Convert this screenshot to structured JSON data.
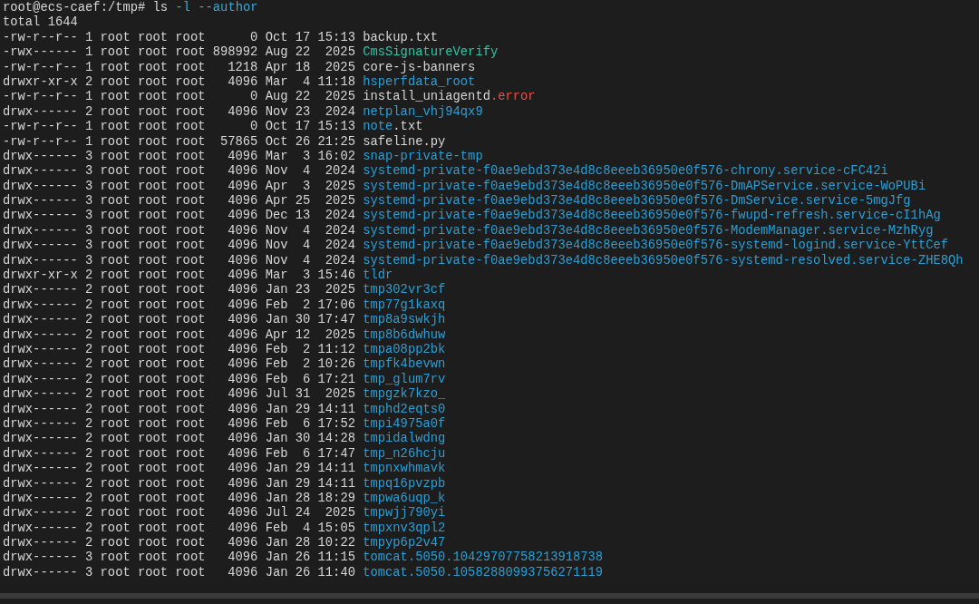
{
  "prompt": {
    "user_host_path": "root@ecs-caef:/tmp#",
    "command": "ls",
    "args": "-l --author"
  },
  "total": "total 1644",
  "entries": [
    {
      "perms": "-rw-r--r--",
      "links": "1",
      "owner": "root",
      "group": "root",
      "author": "root",
      "size": "0",
      "month": "Oct",
      "day": "17",
      "time": "15:13",
      "name": [
        {
          "text": "backup.txt",
          "kind": "plain"
        }
      ]
    },
    {
      "perms": "-rwx------",
      "links": "1",
      "owner": "root",
      "group": "root",
      "author": "root",
      "size": "898992",
      "month": "Aug",
      "day": "22",
      "time": "2025",
      "name": [
        {
          "text": "CmsSignatureVerify",
          "kind": "exec"
        }
      ]
    },
    {
      "perms": "-rw-r--r--",
      "links": "1",
      "owner": "root",
      "group": "root",
      "author": "root",
      "size": "1218",
      "month": "Apr",
      "day": "18",
      "time": "2025",
      "name": [
        {
          "text": "core-js-banners",
          "kind": "plain"
        }
      ]
    },
    {
      "perms": "drwxr-xr-x",
      "links": "2",
      "owner": "root",
      "group": "root",
      "author": "root",
      "size": "4096",
      "month": "Mar",
      "day": "4",
      "time": "11:18",
      "name": [
        {
          "text": "hsperfdata_root",
          "kind": "dir"
        }
      ]
    },
    {
      "perms": "-rw-r--r--",
      "links": "1",
      "owner": "root",
      "group": "root",
      "author": "root",
      "size": "0",
      "month": "Aug",
      "day": "22",
      "time": "2025",
      "name": [
        {
          "text": "install_uniagentd",
          "kind": "plain"
        },
        {
          "text": ".error",
          "kind": "error"
        }
      ]
    },
    {
      "perms": "drwx------",
      "links": "2",
      "owner": "root",
      "group": "root",
      "author": "root",
      "size": "4096",
      "month": "Nov",
      "day": "23",
      "time": "2024",
      "name": [
        {
          "text": "netplan_vhj94qx9",
          "kind": "dir"
        }
      ]
    },
    {
      "perms": "-rw-r--r--",
      "links": "1",
      "owner": "root",
      "group": "root",
      "author": "root",
      "size": "0",
      "month": "Oct",
      "day": "17",
      "time": "15:13",
      "name": [
        {
          "text": "note",
          "kind": "dir"
        },
        {
          "text": ".txt",
          "kind": "plain"
        }
      ]
    },
    {
      "perms": "-rw-r--r--",
      "links": "1",
      "owner": "root",
      "group": "root",
      "author": "root",
      "size": "57865",
      "month": "Oct",
      "day": "26",
      "time": "21:25",
      "name": [
        {
          "text": "safeline.py",
          "kind": "plain"
        }
      ]
    },
    {
      "perms": "drwx------",
      "links": "3",
      "owner": "root",
      "group": "root",
      "author": "root",
      "size": "4096",
      "month": "Mar",
      "day": "3",
      "time": "16:02",
      "name": [
        {
          "text": "snap-private-tmp",
          "kind": "dir"
        }
      ]
    },
    {
      "perms": "drwx------",
      "links": "3",
      "owner": "root",
      "group": "root",
      "author": "root",
      "size": "4096",
      "month": "Nov",
      "day": "4",
      "time": "2024",
      "name": [
        {
          "text": "systemd-private-f0ae9ebd373e4d8c8eeeb36950e0f576-chrony.service-cFC42i",
          "kind": "dir"
        }
      ]
    },
    {
      "perms": "drwx------",
      "links": "3",
      "owner": "root",
      "group": "root",
      "author": "root",
      "size": "4096",
      "month": "Apr",
      "day": "3",
      "time": "2025",
      "name": [
        {
          "text": "systemd-private-f0ae9ebd373e4d8c8eeeb36950e0f576-DmAPService.service-WoPUBi",
          "kind": "dir"
        }
      ]
    },
    {
      "perms": "drwx------",
      "links": "3",
      "owner": "root",
      "group": "root",
      "author": "root",
      "size": "4096",
      "month": "Apr",
      "day": "25",
      "time": "2025",
      "name": [
        {
          "text": "systemd-private-f0ae9ebd373e4d8c8eeeb36950e0f576-DmService.service-5mgJfg",
          "kind": "dir"
        }
      ]
    },
    {
      "perms": "drwx------",
      "links": "3",
      "owner": "root",
      "group": "root",
      "author": "root",
      "size": "4096",
      "month": "Dec",
      "day": "13",
      "time": "2024",
      "name": [
        {
          "text": "systemd-private-f0ae9ebd373e4d8c8eeeb36950e0f576-fwupd-refresh.service-cI1hAg",
          "kind": "dir"
        }
      ]
    },
    {
      "perms": "drwx------",
      "links": "3",
      "owner": "root",
      "group": "root",
      "author": "root",
      "size": "4096",
      "month": "Nov",
      "day": "4",
      "time": "2024",
      "name": [
        {
          "text": "systemd-private-f0ae9ebd373e4d8c8eeeb36950e0f576-ModemManager.service-MzhRyg",
          "kind": "dir"
        }
      ]
    },
    {
      "perms": "drwx------",
      "links": "3",
      "owner": "root",
      "group": "root",
      "author": "root",
      "size": "4096",
      "month": "Nov",
      "day": "4",
      "time": "2024",
      "name": [
        {
          "text": "systemd-private-f0ae9ebd373e4d8c8eeeb36950e0f576-systemd-logind.service-YttCef",
          "kind": "dir"
        }
      ]
    },
    {
      "perms": "drwx------",
      "links": "3",
      "owner": "root",
      "group": "root",
      "author": "root",
      "size": "4096",
      "month": "Nov",
      "day": "4",
      "time": "2024",
      "name": [
        {
          "text": "systemd-private-f0ae9ebd373e4d8c8eeeb36950e0f576-systemd-resolved.service-ZHE8Qh",
          "kind": "dir"
        }
      ]
    },
    {
      "perms": "drwxr-xr-x",
      "links": "2",
      "owner": "root",
      "group": "root",
      "author": "root",
      "size": "4096",
      "month": "Mar",
      "day": "3",
      "time": "15:46",
      "name": [
        {
          "text": "tldr",
          "kind": "dir"
        }
      ]
    },
    {
      "perms": "drwx------",
      "links": "2",
      "owner": "root",
      "group": "root",
      "author": "root",
      "size": "4096",
      "month": "Jan",
      "day": "23",
      "time": "2025",
      "name": [
        {
          "text": "tmp302vr3cf",
          "kind": "dir"
        }
      ]
    },
    {
      "perms": "drwx------",
      "links": "2",
      "owner": "root",
      "group": "root",
      "author": "root",
      "size": "4096",
      "month": "Feb",
      "day": "2",
      "time": "17:06",
      "name": [
        {
          "text": "tmp77g1kaxq",
          "kind": "dir"
        }
      ]
    },
    {
      "perms": "drwx------",
      "links": "2",
      "owner": "root",
      "group": "root",
      "author": "root",
      "size": "4096",
      "month": "Jan",
      "day": "30",
      "time": "17:47",
      "name": [
        {
          "text": "tmp8a9swkjh",
          "kind": "dir"
        }
      ]
    },
    {
      "perms": "drwx------",
      "links": "2",
      "owner": "root",
      "group": "root",
      "author": "root",
      "size": "4096",
      "month": "Apr",
      "day": "12",
      "time": "2025",
      "name": [
        {
          "text": "tmp8b6dwhuw",
          "kind": "dir"
        }
      ]
    },
    {
      "perms": "drwx------",
      "links": "2",
      "owner": "root",
      "group": "root",
      "author": "root",
      "size": "4096",
      "month": "Feb",
      "day": "2",
      "time": "11:12",
      "name": [
        {
          "text": "tmpa08pp2bk",
          "kind": "dir"
        }
      ]
    },
    {
      "perms": "drwx------",
      "links": "2",
      "owner": "root",
      "group": "root",
      "author": "root",
      "size": "4096",
      "month": "Feb",
      "day": "2",
      "time": "10:26",
      "name": [
        {
          "text": "tmpfk4bevwn",
          "kind": "dir"
        }
      ]
    },
    {
      "perms": "drwx------",
      "links": "2",
      "owner": "root",
      "group": "root",
      "author": "root",
      "size": "4096",
      "month": "Feb",
      "day": "6",
      "time": "17:21",
      "name": [
        {
          "text": "tmp_glum7rv",
          "kind": "dir"
        }
      ]
    },
    {
      "perms": "drwx------",
      "links": "2",
      "owner": "root",
      "group": "root",
      "author": "root",
      "size": "4096",
      "month": "Jul",
      "day": "31",
      "time": "2025",
      "name": [
        {
          "text": "tmpgzk7kzo_",
          "kind": "dir"
        }
      ]
    },
    {
      "perms": "drwx------",
      "links": "2",
      "owner": "root",
      "group": "root",
      "author": "root",
      "size": "4096",
      "month": "Jan",
      "day": "29",
      "time": "14:11",
      "name": [
        {
          "text": "tmphd2eqts0",
          "kind": "dir"
        }
      ]
    },
    {
      "perms": "drwx------",
      "links": "2",
      "owner": "root",
      "group": "root",
      "author": "root",
      "size": "4096",
      "month": "Feb",
      "day": "6",
      "time": "17:52",
      "name": [
        {
          "text": "tmpi4975a0f",
          "kind": "dir"
        }
      ]
    },
    {
      "perms": "drwx------",
      "links": "2",
      "owner": "root",
      "group": "root",
      "author": "root",
      "size": "4096",
      "month": "Jan",
      "day": "30",
      "time": "14:28",
      "name": [
        {
          "text": "tmpidalwdng",
          "kind": "dir"
        }
      ]
    },
    {
      "perms": "drwx------",
      "links": "2",
      "owner": "root",
      "group": "root",
      "author": "root",
      "size": "4096",
      "month": "Feb",
      "day": "6",
      "time": "17:47",
      "name": [
        {
          "text": "tmp_n26hcju",
          "kind": "dir"
        }
      ]
    },
    {
      "perms": "drwx------",
      "links": "2",
      "owner": "root",
      "group": "root",
      "author": "root",
      "size": "4096",
      "month": "Jan",
      "day": "29",
      "time": "14:11",
      "name": [
        {
          "text": "tmpnxwhmavk",
          "kind": "dir"
        }
      ]
    },
    {
      "perms": "drwx------",
      "links": "2",
      "owner": "root",
      "group": "root",
      "author": "root",
      "size": "4096",
      "month": "Jan",
      "day": "29",
      "time": "14:11",
      "name": [
        {
          "text": "tmpq16pvzpb",
          "kind": "dir"
        }
      ]
    },
    {
      "perms": "drwx------",
      "links": "2",
      "owner": "root",
      "group": "root",
      "author": "root",
      "size": "4096",
      "month": "Jan",
      "day": "28",
      "time": "18:29",
      "name": [
        {
          "text": "tmpwa6uqp_k",
          "kind": "dir"
        }
      ]
    },
    {
      "perms": "drwx------",
      "links": "2",
      "owner": "root",
      "group": "root",
      "author": "root",
      "size": "4096",
      "month": "Jul",
      "day": "24",
      "time": "2025",
      "name": [
        {
          "text": "tmpwjj790yi",
          "kind": "dir"
        }
      ]
    },
    {
      "perms": "drwx------",
      "links": "2",
      "owner": "root",
      "group": "root",
      "author": "root",
      "size": "4096",
      "month": "Feb",
      "day": "4",
      "time": "15:05",
      "name": [
        {
          "text": "tmpxnv3qpl2",
          "kind": "dir"
        }
      ]
    },
    {
      "perms": "drwx------",
      "links": "2",
      "owner": "root",
      "group": "root",
      "author": "root",
      "size": "4096",
      "month": "Jan",
      "day": "28",
      "time": "10:22",
      "name": [
        {
          "text": "tmpyp6p2v47",
          "kind": "dir"
        }
      ]
    },
    {
      "perms": "drwx------",
      "links": "3",
      "owner": "root",
      "group": "root",
      "author": "root",
      "size": "4096",
      "month": "Jan",
      "day": "26",
      "time": "11:15",
      "name": [
        {
          "text": "tomcat.5050.10429707758213918738",
          "kind": "dir"
        }
      ]
    },
    {
      "perms": "drwx------",
      "links": "3",
      "owner": "root",
      "group": "root",
      "author": "root",
      "size": "4096",
      "month": "Jan",
      "day": "26",
      "time": "11:40",
      "name": [
        {
          "text": "tomcat.5050.10582880993756271119",
          "kind": "dir"
        }
      ]
    }
  ]
}
